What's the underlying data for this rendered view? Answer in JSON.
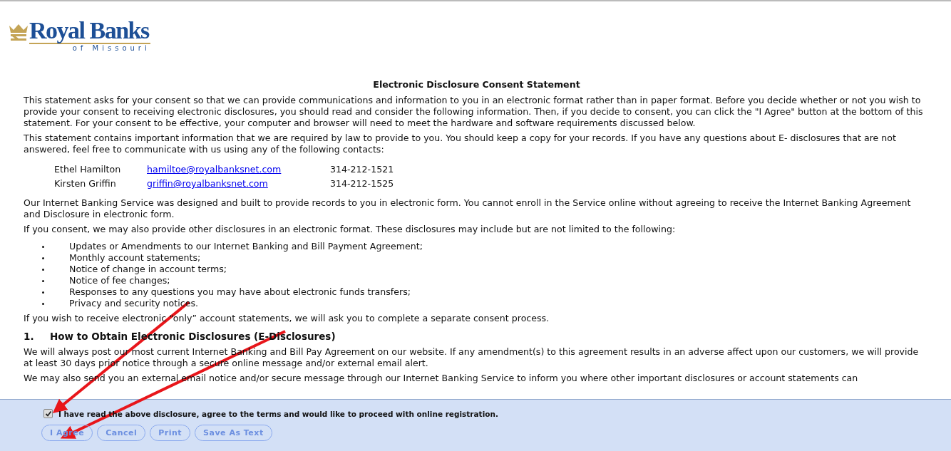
{
  "logo": {
    "name": "Royal Banks",
    "tagline": "of Missouri"
  },
  "title": "Electronic Disclosure Consent Statement",
  "intro": [
    "This statement asks for your consent so that we can provide communications and information to you in an electronic format rather than in paper format.  Before you decide whether or not you wish to provide your consent to receiving electronic disclosures, you should read and consider the following information. Then, if you decide to consent, you can click the \"I Agree\" button at the bottom of this statement.  For your consent to be effective, your computer and browser will need to meet the hardware and software requirements discussed below.",
    "This statement contains important information that we are required by law to provide to you. You should keep a copy for your records. If you have any questions about E- disclosures that are not answered, feel free to communicate with us using any of the following contacts:"
  ],
  "contacts": [
    {
      "name": "Ethel Hamilton",
      "email": "hamiltoe@royalbanksnet.com",
      "phone": "314-212-1521"
    },
    {
      "name": "Kirsten Griffin",
      "email": "griffin@royalbanksnet.com",
      "phone": "314-212-1525"
    }
  ],
  "middle": [
    "Our Internet Banking Service was designed and built to provide records to you in electronic form.  You cannot enroll in the Service online without agreeing to receive the Internet Banking Agreement and Disclosure in electronic form.",
    "If you consent, we may also provide other disclosures in an electronic format.  These disclosures may include but are not limited to the following:"
  ],
  "bullets": [
    "Updates or Amendments to our Internet Banking and Bill Payment Agreement;",
    "Monthly account statements;",
    "Notice of change in account terms;",
    "Notice of fee changes;",
    "Responses to any questions you may have about electronic funds transfers;",
    "Privacy and security notices."
  ],
  "after_list": "If you wish to receive electronic “only” account statements, we will ask you to complete a separate consent process.",
  "section": {
    "number": "1.",
    "heading": "How to Obtain Electronic Disclosures (E-Disclosures)",
    "paragraphs": [
      "We will always post our most current Internet Banking and Bill Pay Agreement on our website.  If any amendment(s) to this agreement results in an adverse affect upon our customers, we will provide at least 30 days prior notice through a secure online message and/or external email alert.",
      "We may also send you an external email notice and/or secure message through our Internet Banking Service to inform you where other important disclosures or account statements can"
    ]
  },
  "consent": {
    "label": "I have read the above disclosure, agree to the terms and would like to proceed with online registration.",
    "checked": true
  },
  "buttons": [
    "I Agree",
    "Cancel",
    "Print",
    "Save As Text"
  ]
}
